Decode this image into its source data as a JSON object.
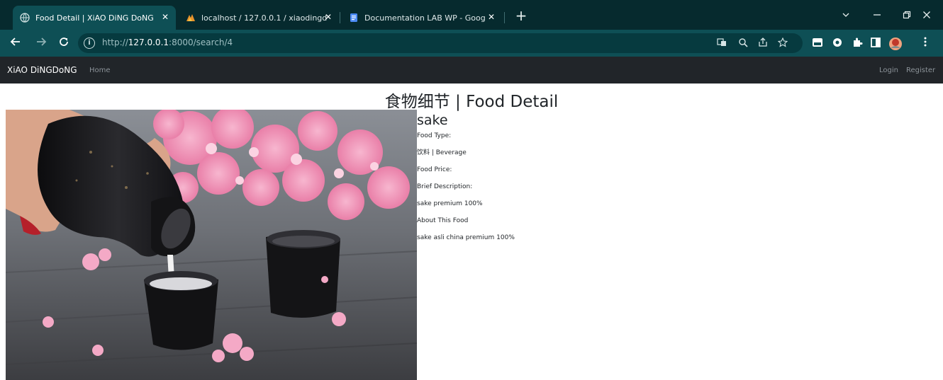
{
  "browser": {
    "tabs": [
      {
        "title": "Food Detail | XiAO DiNG DoNG",
        "active": true,
        "icon": "globe-icon"
      },
      {
        "title": "localhost / 127.0.0.1 / xiaodingd",
        "active": false,
        "icon": "phpmyadmin-icon"
      },
      {
        "title": "Documentation LAB WP - Goog",
        "active": false,
        "icon": "google-docs-icon"
      }
    ],
    "new_tab": "+",
    "address": {
      "scheme": "http://",
      "host": "127.0.0.1",
      "rest": ":8000/search/4"
    }
  },
  "site": {
    "brand": "XiAO DiNGDoNG",
    "nav": {
      "home": "Home",
      "login": "Login",
      "register": "Register"
    }
  },
  "page": {
    "title": "食物细节 | Food Detail",
    "food": {
      "name": "sake",
      "type_label": "Food Type:",
      "type_value": "饮料 | Beverage",
      "price_label": "Food Price:",
      "desc_label": "Brief Description:",
      "desc_value": "sake premium 100%",
      "about_label": "About This Food",
      "about_value": "sake asli china premium 100%"
    }
  },
  "colors": {
    "tab_strip": "#062a2e",
    "toolbar": "#0e4f55",
    "navbar": "#212529"
  }
}
